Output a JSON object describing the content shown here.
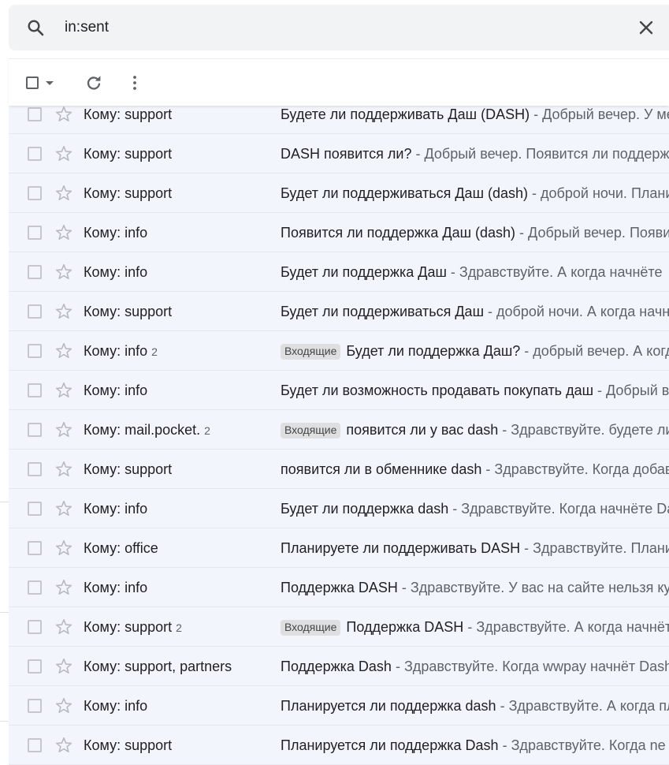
{
  "search": {
    "value": "in:sent",
    "icon": "search-icon",
    "clear_icon": "close-icon"
  },
  "toolbar": {
    "select_icon": "checkbox-icon",
    "select_menu_icon": "chevron-down-icon",
    "refresh_icon": "refresh-icon",
    "more_icon": "more-vert-icon"
  },
  "colors": {
    "row_background": "#f2f6fc",
    "badge_background": "#dddfe1",
    "search_background": "#f1f3f4"
  },
  "emails": [
    {
      "sender": "Кому: support",
      "count": "",
      "badge": "",
      "subject": "Будете ли поддерживать Даш (DASH)",
      "snippet": "Добрый вечер. У меня вопрос"
    },
    {
      "sender": "Кому: support",
      "count": "",
      "badge": "",
      "subject": "DASH появится ли?",
      "snippet": "Добрый вечер. Появится ли поддержка"
    },
    {
      "sender": "Кому: support",
      "count": "",
      "badge": "",
      "subject": "Будет ли поддерживаться Даш (dash)",
      "snippet": "доброй ночи. Планируете"
    },
    {
      "sender": "Кому: info",
      "count": "",
      "badge": "",
      "subject": "Появится ли поддержка Даш (dash)",
      "snippet": "Добрый вечер. Появится"
    },
    {
      "sender": "Кому: info",
      "count": "",
      "badge": "",
      "subject": "Будет ли поддержка Даш",
      "snippet": "Здравствуйте. А когда начнёте"
    },
    {
      "sender": "Кому: support",
      "count": "",
      "badge": "",
      "subject": "Будет ли поддерживаться Даш",
      "snippet": "доброй ночи. А когда начнёте"
    },
    {
      "sender": "Кому: info",
      "count": "2",
      "badge": "Входящие",
      "subject": "Будет ли поддержка Даш?",
      "snippet": "добрый вечер. А когда"
    },
    {
      "sender": "Кому: info",
      "count": "",
      "badge": "",
      "subject": "Будет ли возможность продавать покупать даш",
      "snippet": "Добрый вечер"
    },
    {
      "sender": "Кому: mail.pocket.",
      "count": "2",
      "badge": "Входящие",
      "subject": "появится ли у вас dash",
      "snippet": "Здравствуйте. будете ли"
    },
    {
      "sender": "Кому: support",
      "count": "",
      "badge": "",
      "subject": "появится ли в обменнике dash",
      "snippet": "Здравствуйте. Когда добавите"
    },
    {
      "sender": "Кому: info",
      "count": "",
      "badge": "",
      "subject": "Будет ли поддержка dash",
      "snippet": "Здравствуйте. Когда начнёте Dash"
    },
    {
      "sender": "Кому: office",
      "count": "",
      "badge": "",
      "subject": "Планируете ли поддерживать DASH",
      "snippet": "Здравствуйте. Планируете"
    },
    {
      "sender": "Кому: info",
      "count": "",
      "badge": "",
      "subject": "Поддержка DASH",
      "snippet": "Здравствуйте. У вас на сайте нельзя купить"
    },
    {
      "sender": "Кому: support",
      "count": "2",
      "badge": "Входящие",
      "subject": "Поддержка DASH",
      "snippet": "Здравствуйте. А когда начнёте"
    },
    {
      "sender": "Кому: support, partners",
      "count": "",
      "badge": "",
      "subject": "Поддержка Dash",
      "snippet": "Здравствуйте. Когда wwpay начнёт Dash"
    },
    {
      "sender": "Кому: info",
      "count": "",
      "badge": "",
      "subject": "Планируется ли поддержка dash",
      "snippet": "Здравствуйте. А когда планируете"
    },
    {
      "sender": "Кому: support",
      "count": "",
      "badge": "",
      "subject": "Планируется ли поддержка Dash",
      "snippet": "Здравствуйте. Когда ne"
    }
  ]
}
